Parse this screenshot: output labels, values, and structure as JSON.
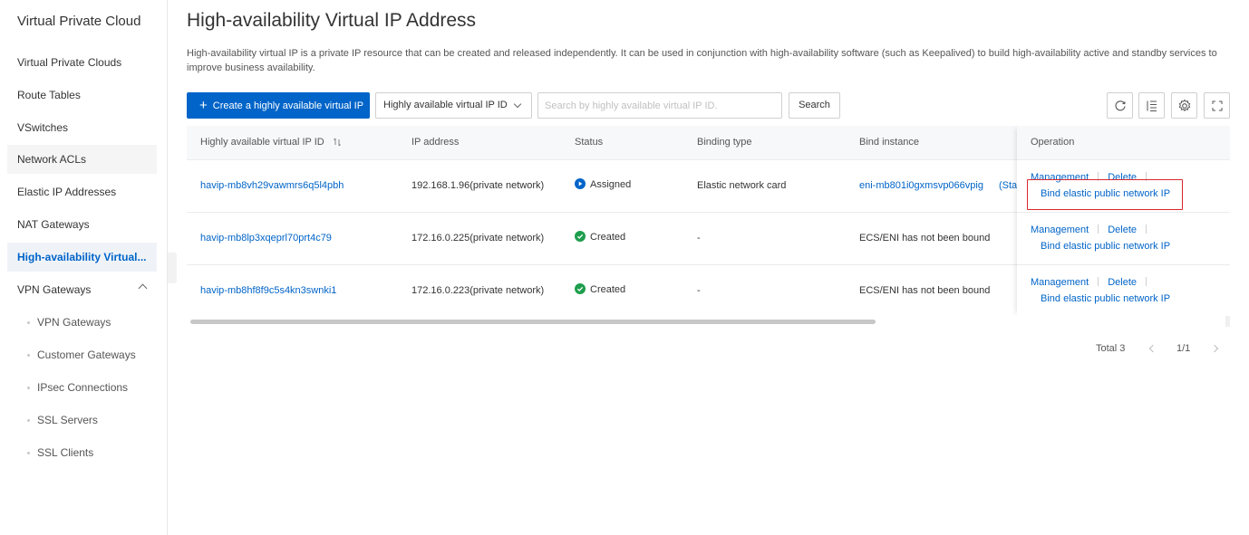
{
  "sidebar": {
    "title": "Virtual Private Cloud",
    "items": [
      {
        "label": "Virtual Private Clouds"
      },
      {
        "label": "Route Tables"
      },
      {
        "label": "VSwitches"
      },
      {
        "label": "Network ACLs"
      },
      {
        "label": "Elastic IP Addresses"
      },
      {
        "label": "NAT Gateways"
      },
      {
        "label": "High-availability Virtual..."
      },
      {
        "label": "VPN Gateways"
      }
    ],
    "vpn_subitems": [
      {
        "label": "VPN Gateways"
      },
      {
        "label": "Customer Gateways"
      },
      {
        "label": "IPsec Connections"
      },
      {
        "label": "SSL Servers"
      },
      {
        "label": "SSL Clients"
      }
    ]
  },
  "page": {
    "title": "High-availability Virtual IP Address",
    "description": "High-availability virtual IP is a private IP resource that can be created and released independently. It can be used in conjunction with high-availability software (such as Keepalived) to build high-availability active and standby services to improve business availability."
  },
  "toolbar": {
    "create_label": "Create a highly available virtual IP",
    "filter_select": "Highly available virtual IP ID",
    "search_placeholder": "Search by highly available virtual IP ID.",
    "search_label": "Search"
  },
  "table": {
    "headers": {
      "id": "Highly available virtual IP ID",
      "ip": "IP address",
      "status": "Status",
      "binding_type": "Binding type",
      "bind_instance": "Bind instance",
      "operation": "Operation"
    },
    "rows": [
      {
        "id": "havip-mb8vh29vawmrs6q5l4pbh",
        "ip": "192.168.1.96(private network)",
        "status": "Assigned",
        "binding_type": "Elastic network card",
        "bind_instance": "eni-mb801i0gxmsvp066vpig",
        "bind_extra": "(Star",
        "op_manage": "Management",
        "op_delete": "Delete",
        "op_bind": "Bind elastic public network IP"
      },
      {
        "id": "havip-mb8lp3xqeprl70prt4c79",
        "ip": "172.16.0.225(private network)",
        "status": "Created",
        "binding_type": "-",
        "bind_instance": "ECS/ENI has not been bound",
        "bind_extra": "",
        "op_manage": "Management",
        "op_delete": "Delete",
        "op_bind": "Bind elastic public network IP"
      },
      {
        "id": "havip-mb8hf8f9c5s4kn3swnki1",
        "ip": "172.16.0.223(private network)",
        "status": "Created",
        "binding_type": "-",
        "bind_instance": "ECS/ENI has not been bound",
        "bind_extra": "",
        "op_manage": "Management",
        "op_delete": "Delete",
        "op_bind": "Bind elastic public network IP"
      }
    ]
  },
  "pagination": {
    "total": "Total 3",
    "page": "1/1"
  },
  "colors": {
    "accent": "#0064c8",
    "highlight": "#d8262d",
    "status_assigned": "#0064c8",
    "status_created": "#1e9e4d"
  },
  "icons": [
    "plus-icon",
    "chevron-down-icon",
    "refresh-icon",
    "column-settings-icon",
    "gear-icon",
    "fullscreen-icon",
    "sort-icon",
    "play-icon",
    "check-icon",
    "chevron-up-icon",
    "chevron-left-icon",
    "chevron-right-icon"
  ]
}
